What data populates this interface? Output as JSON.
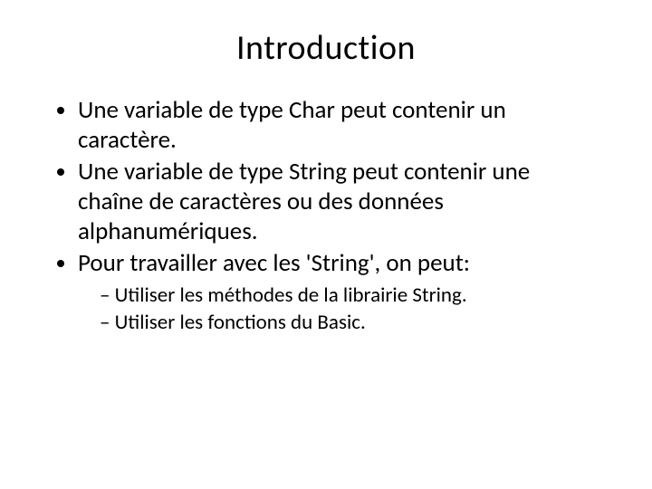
{
  "title": "Introduction",
  "bullets": [
    {
      "text": "Une variable de type Char peut contenir un caractère."
    },
    {
      "text": "Une variable de type String peut contenir une chaîne de caractères ou des données alphanumériques."
    },
    {
      "text": "Pour travailler avec les 'String', on peut:"
    }
  ],
  "subbullets": [
    {
      "text": "Utiliser les méthodes de la librairie String."
    },
    {
      "text": "Utiliser les fonctions du Basic."
    }
  ]
}
